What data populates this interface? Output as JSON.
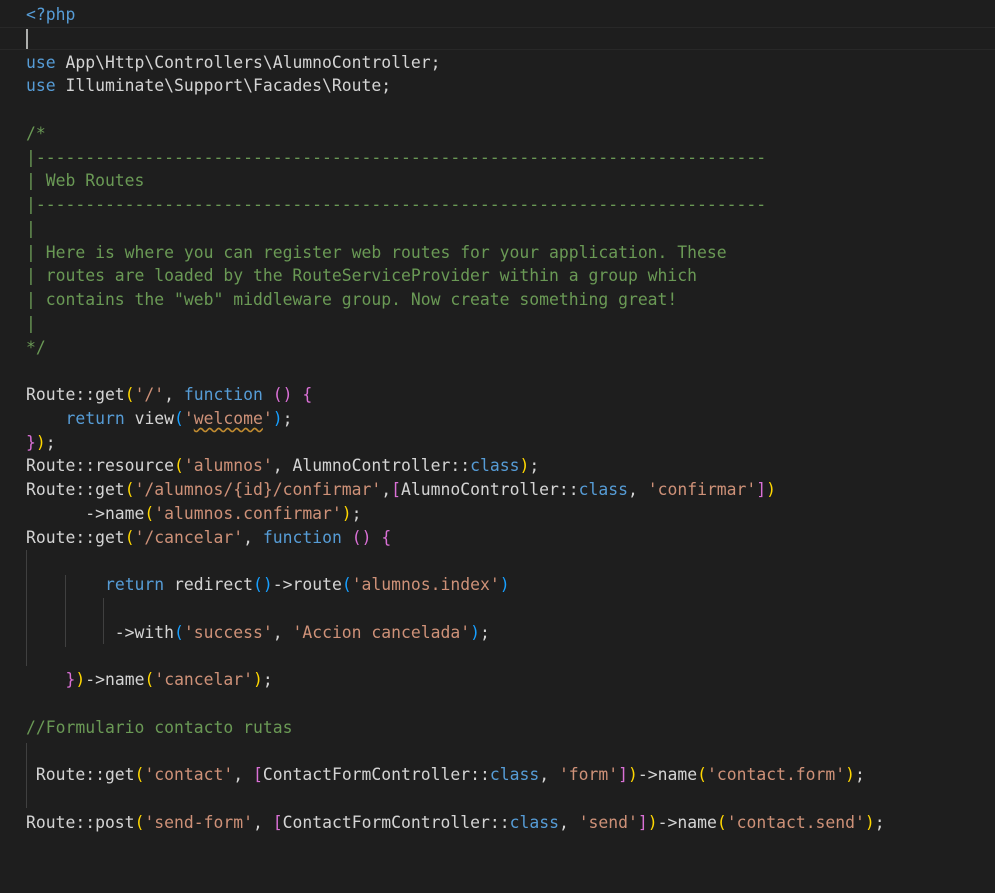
{
  "editor": {
    "theme": "dark",
    "background": "#1e1e1e",
    "colors": {
      "keyword": "#569cd6",
      "string": "#ce9178",
      "comment": "#6a9955",
      "plain": "#d4d4d4",
      "bracket_gold": "#ffd700",
      "bracket_orchid": "#da70d6",
      "bracket_blue": "#179fff"
    },
    "lines": [
      {
        "tokens": [
          {
            "t": "<?php",
            "c": "meta"
          }
        ]
      },
      {
        "tokens": []
      },
      {
        "tokens": [
          {
            "t": "use",
            "c": "kw"
          },
          {
            "t": " App\\Http\\Controllers\\AlumnoController;",
            "c": "txt"
          }
        ]
      },
      {
        "tokens": [
          {
            "t": "use",
            "c": "kw"
          },
          {
            "t": " Illuminate\\Support\\Facades\\Route;",
            "c": "txt"
          }
        ]
      },
      {
        "tokens": []
      },
      {
        "tokens": [
          {
            "t": "/*",
            "c": "com"
          }
        ]
      },
      {
        "tokens": [
          {
            "t": "|--------------------------------------------------------------------------",
            "c": "com"
          }
        ]
      },
      {
        "tokens": [
          {
            "t": "| Web Routes",
            "c": "com"
          }
        ]
      },
      {
        "tokens": [
          {
            "t": "|--------------------------------------------------------------------------",
            "c": "com"
          }
        ]
      },
      {
        "tokens": [
          {
            "t": "|",
            "c": "com"
          }
        ]
      },
      {
        "tokens": [
          {
            "t": "| Here is where you can register web routes for your application. These",
            "c": "com"
          }
        ]
      },
      {
        "tokens": [
          {
            "t": "| routes are loaded by the RouteServiceProvider within a group which",
            "c": "com"
          }
        ]
      },
      {
        "tokens": [
          {
            "t": "| contains the \"web\" middleware group. Now create something great!",
            "c": "com"
          }
        ]
      },
      {
        "tokens": [
          {
            "t": "|",
            "c": "com"
          }
        ]
      },
      {
        "tokens": [
          {
            "t": "*/",
            "c": "com"
          }
        ]
      },
      {
        "tokens": []
      },
      {
        "tokens": [
          {
            "t": "Route::get",
            "c": "txt"
          },
          {
            "t": "(",
            "c": "p1"
          },
          {
            "t": "'/'",
            "c": "str"
          },
          {
            "t": ", ",
            "c": "txt"
          },
          {
            "t": "function",
            "c": "kw"
          },
          {
            "t": " ",
            "c": "txt"
          },
          {
            "t": "()",
            "c": "p2"
          },
          {
            "t": " ",
            "c": "txt"
          },
          {
            "t": "{",
            "c": "p2"
          }
        ]
      },
      {
        "tokens": [
          {
            "t": "    ",
            "c": "txt"
          },
          {
            "t": "return",
            "c": "kw"
          },
          {
            "t": " view",
            "c": "txt"
          },
          {
            "t": "(",
            "c": "p3"
          },
          {
            "t": "'",
            "c": "str"
          },
          {
            "t": "welcome",
            "c": "str_sq"
          },
          {
            "t": "'",
            "c": "str"
          },
          {
            "t": ")",
            "c": "p3"
          },
          {
            "t": ";",
            "c": "txt"
          }
        ]
      },
      {
        "tokens": [
          {
            "t": "}",
            "c": "p2"
          },
          {
            "t": ")",
            "c": "p1"
          },
          {
            "t": ";",
            "c": "txt"
          }
        ]
      },
      {
        "tokens": [
          {
            "t": "Route::resource",
            "c": "txt"
          },
          {
            "t": "(",
            "c": "p1"
          },
          {
            "t": "'alumnos'",
            "c": "str"
          },
          {
            "t": ", AlumnoController::",
            "c": "txt"
          },
          {
            "t": "class",
            "c": "kw"
          },
          {
            "t": ")",
            "c": "p1"
          },
          {
            "t": ";",
            "c": "txt"
          }
        ]
      },
      {
        "tokens": [
          {
            "t": "Route::get",
            "c": "txt"
          },
          {
            "t": "(",
            "c": "p1"
          },
          {
            "t": "'/alumnos/{id}/confirmar'",
            "c": "str"
          },
          {
            "t": ",",
            "c": "txt"
          },
          {
            "t": "[",
            "c": "p2"
          },
          {
            "t": "AlumnoController::",
            "c": "txt"
          },
          {
            "t": "class",
            "c": "kw"
          },
          {
            "t": ", ",
            "c": "txt"
          },
          {
            "t": "'confirmar'",
            "c": "str"
          },
          {
            "t": "]",
            "c": "p2"
          },
          {
            "t": ")",
            "c": "p1"
          }
        ]
      },
      {
        "tokens": [
          {
            "t": "      ->name",
            "c": "txt"
          },
          {
            "t": "(",
            "c": "p1"
          },
          {
            "t": "'alumnos.confirmar'",
            "c": "str"
          },
          {
            "t": ")",
            "c": "p1"
          },
          {
            "t": ";",
            "c": "txt"
          }
        ]
      },
      {
        "tokens": [
          {
            "t": "Route::get",
            "c": "txt"
          },
          {
            "t": "(",
            "c": "p1"
          },
          {
            "t": "'/cancelar'",
            "c": "str"
          },
          {
            "t": ", ",
            "c": "txt"
          },
          {
            "t": "function",
            "c": "kw"
          },
          {
            "t": " ",
            "c": "txt"
          },
          {
            "t": "()",
            "c": "p2"
          },
          {
            "t": " ",
            "c": "txt"
          },
          {
            "t": "{",
            "c": "p2"
          }
        ]
      },
      {
        "tokens": []
      },
      {
        "tokens": [
          {
            "t": "        ",
            "c": "txt"
          },
          {
            "t": "return",
            "c": "kw"
          },
          {
            "t": " redirect",
            "c": "txt"
          },
          {
            "t": "()",
            "c": "p3"
          },
          {
            "t": "->route",
            "c": "txt"
          },
          {
            "t": "(",
            "c": "p3"
          },
          {
            "t": "'alumnos.index'",
            "c": "str"
          },
          {
            "t": ")",
            "c": "p3"
          }
        ]
      },
      {
        "tokens": []
      },
      {
        "tokens": [
          {
            "t": "         ->with",
            "c": "txt"
          },
          {
            "t": "(",
            "c": "p3"
          },
          {
            "t": "'success'",
            "c": "str"
          },
          {
            "t": ", ",
            "c": "txt"
          },
          {
            "t": "'Accion cancelada'",
            "c": "str"
          },
          {
            "t": ")",
            "c": "p3"
          },
          {
            "t": ";",
            "c": "txt"
          }
        ]
      },
      {
        "tokens": []
      },
      {
        "tokens": [
          {
            "t": "    ",
            "c": "txt"
          },
          {
            "t": "}",
            "c": "p2"
          },
          {
            "t": ")",
            "c": "p1"
          },
          {
            "t": "->name",
            "c": "txt"
          },
          {
            "t": "(",
            "c": "p1"
          },
          {
            "t": "'cancelar'",
            "c": "str"
          },
          {
            "t": ")",
            "c": "p1"
          },
          {
            "t": ";",
            "c": "txt"
          }
        ]
      },
      {
        "tokens": []
      },
      {
        "tokens": [
          {
            "t": "//Formulario contacto rutas",
            "c": "com"
          }
        ]
      },
      {
        "tokens": []
      },
      {
        "tokens": [
          {
            "t": " Route::get",
            "c": "txt"
          },
          {
            "t": "(",
            "c": "p1"
          },
          {
            "t": "'contact'",
            "c": "str"
          },
          {
            "t": ", ",
            "c": "txt"
          },
          {
            "t": "[",
            "c": "p2"
          },
          {
            "t": "ContactFormController::",
            "c": "txt"
          },
          {
            "t": "class",
            "c": "kw"
          },
          {
            "t": ", ",
            "c": "txt"
          },
          {
            "t": "'form'",
            "c": "str"
          },
          {
            "t": "]",
            "c": "p2"
          },
          {
            "t": ")",
            "c": "p1"
          },
          {
            "t": "->name",
            "c": "txt"
          },
          {
            "t": "(",
            "c": "p1"
          },
          {
            "t": "'contact.form'",
            "c": "str"
          },
          {
            "t": ")",
            "c": "p1"
          },
          {
            "t": ";",
            "c": "txt"
          }
        ]
      },
      {
        "tokens": []
      },
      {
        "tokens": [
          {
            "t": "Route::post",
            "c": "txt"
          },
          {
            "t": "(",
            "c": "p1"
          },
          {
            "t": "'send-form'",
            "c": "str"
          },
          {
            "t": ", ",
            "c": "txt"
          },
          {
            "t": "[",
            "c": "p2"
          },
          {
            "t": "ContactFormController::",
            "c": "txt"
          },
          {
            "t": "class",
            "c": "kw"
          },
          {
            "t": ", ",
            "c": "txt"
          },
          {
            "t": "'send'",
            "c": "str"
          },
          {
            "t": "]",
            "c": "p2"
          },
          {
            "t": ")",
            "c": "p1"
          },
          {
            "t": "->name",
            "c": "txt"
          },
          {
            "t": "(",
            "c": "p1"
          },
          {
            "t": "'contact.send'",
            "c": "str"
          },
          {
            "t": ")",
            "c": "p1"
          },
          {
            "t": ";",
            "c": "txt"
          }
        ]
      }
    ]
  }
}
